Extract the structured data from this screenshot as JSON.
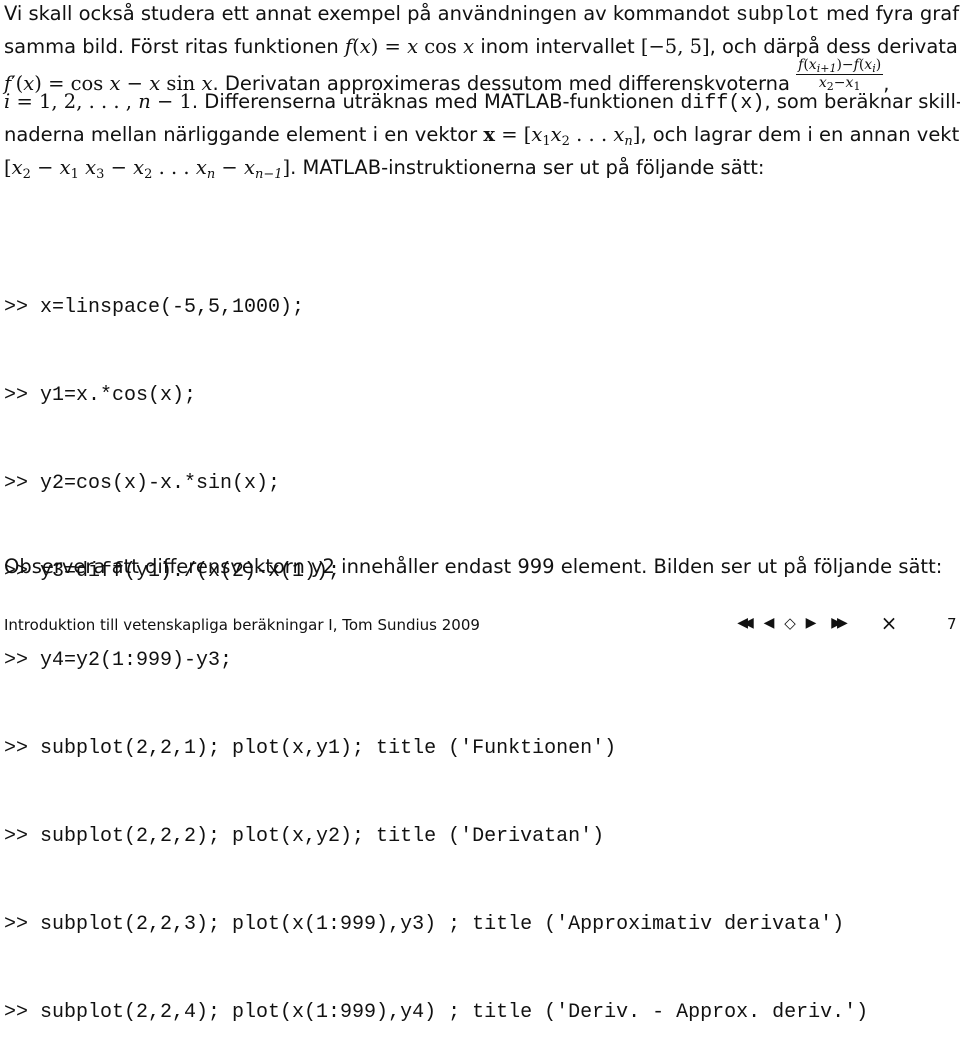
{
  "paragraph1": {
    "t1": "Vi skall också studera ett annat exempel på användningen av kommandot ",
    "cmd_subplot": "subplot",
    "t2": " med fyra grafer i samma bild. Först ritas funktionen ",
    "f_def": "f(x) = x cos x",
    "t3": " inom intervallet ",
    "interval": "[−5, 5]",
    "t4": ", och därpå dess derivata ",
    "deriv": "f′(x) = cos x − x sin x",
    "t5": ". Derivatan approximeras dessutom med differenskvoterna ",
    "frac_num": "f(x",
    "frac_num_sub": "i+1",
    "frac_num_mid": ")−f(x",
    "frac_num_sub2": "i",
    "frac_num_end": ")",
    "frac_den": "x",
    "frac_den_sub1": "2",
    "frac_den_mid": "−x",
    "frac_den_sub2": "1",
    "t6": ",",
    "index_range": "i = 1, 2, . . . , n − 1",
    "t7": ". Differenserna uträknas med MATLAB-funktionen ",
    "cmd_diff": "diff(x)",
    "t8": ", som beräknar skill-naderna mellan närliggande element i en vektor ",
    "vec_x": "x",
    "vec_def": " = [x₁x₂ . . . xₙ]",
    "t9": ", och lagrar dem i en annan vektor: ",
    "diff_vec": "[x₂ − x₁ x₃ − x₂ . . . xₙ − xₙ₋₁]",
    "t10": ". MATLAB-instruktionerna ser ut på följande sätt:"
  },
  "code": [
    ">> x=linspace(-5,5,1000);",
    ">> y1=x.*cos(x);",
    ">> y2=cos(x)-x.*sin(x);",
    ">> y3=diff(y1)./(x(2)-x(1));",
    ">> y4=y2(1:999)-y3;",
    ">> subplot(2,2,1); plot(x,y1); title ('Funktionen')",
    ">> subplot(2,2,2); plot(x,y2); title ('Derivatan')",
    ">> subplot(2,2,3); plot(x(1:999),y3) ; title ('Approximativ derivata')",
    ">> subplot(2,2,4); plot(x(1:999),y4) ; title ('Deriv. - Approx. deriv.')"
  ],
  "paragraph2": "Observera att differensvektorn y2 innehåller endast 999 element. Bilden ser ut på följande sätt:",
  "footer": {
    "text": "Introduktion till vetenskapliga beräkningar I, Tom Sundius 2009",
    "nav": {
      "first": "◀◀",
      "prev": "◀",
      "home": "◇",
      "next": "▶",
      "last": "▶▶",
      "close": "×"
    },
    "page_number": "7"
  }
}
